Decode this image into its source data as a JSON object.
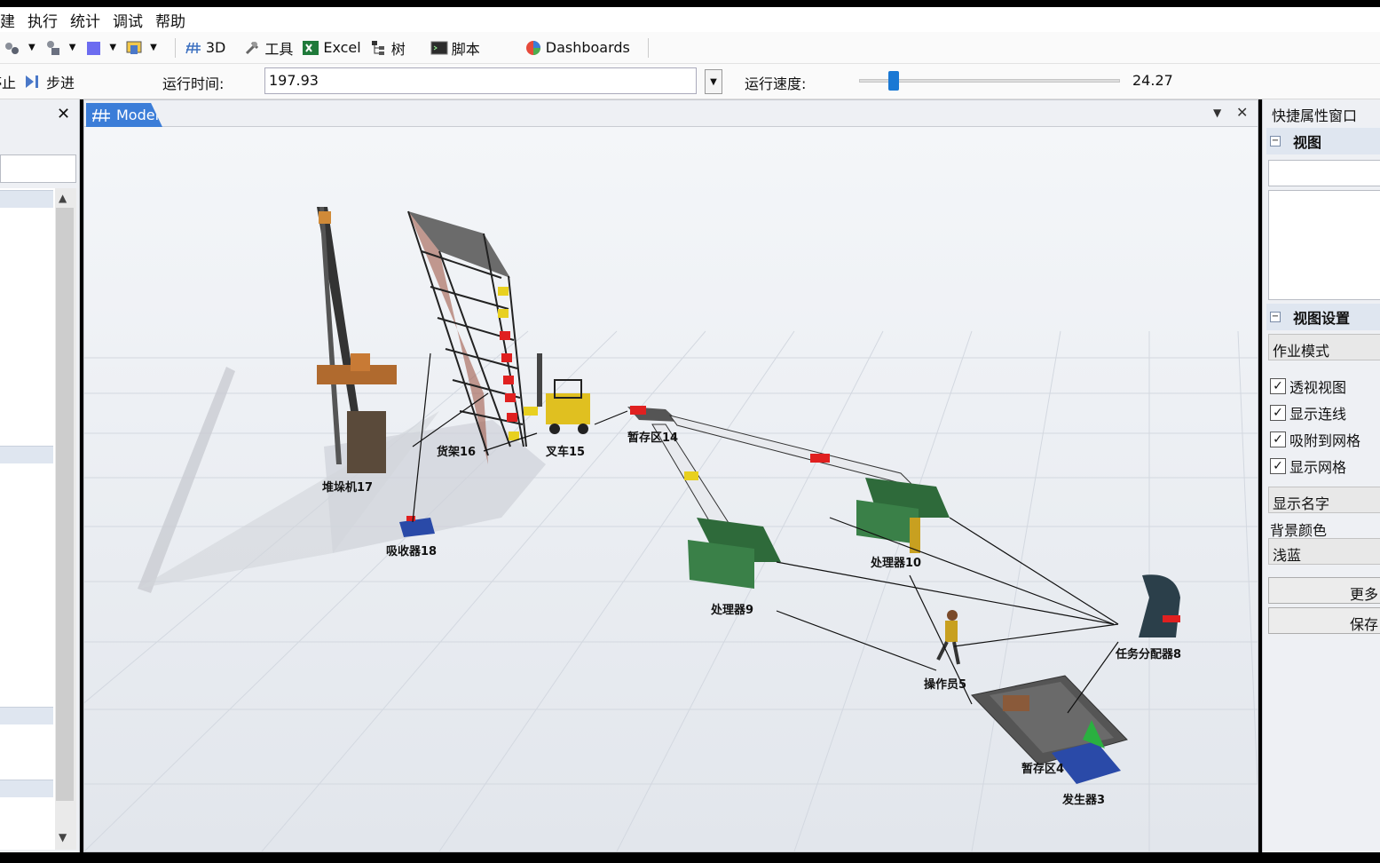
{
  "menu": [
    "建",
    "执行",
    "统计",
    "调试",
    "帮助"
  ],
  "toolbar": {
    "items": [
      {
        "icon": "connect-icon",
        "label": ""
      },
      {
        "icon": "objects-icon",
        "label": ""
      },
      {
        "icon": "color-square-icon",
        "label": ""
      },
      {
        "icon": "view-icon",
        "label": ""
      }
    ],
    "btn_3d": "3D",
    "btn_tools": "工具",
    "btn_excel": "Excel",
    "btn_tree": "树",
    "btn_script": "脚本",
    "btn_dashboards": "Dashboards"
  },
  "runbar": {
    "stop": "停止",
    "step": "步进",
    "time_label": "运行时间:",
    "time_value": "197.93",
    "speed_label": "运行速度:",
    "speed_value": "24.27"
  },
  "model_tab": "Model",
  "scene_labels": {
    "stacker": "堆垛机17",
    "rack": "货架16",
    "forklift": "叉车15",
    "queue14": "暂存区14",
    "absorber": "吸收器18",
    "processor10": "处理器10",
    "processor9": "处理器9",
    "dispatcher": "任务分配器8",
    "operator": "操作员5",
    "queue4": "暂存区4",
    "source": "发生器3"
  },
  "right": {
    "title": "快捷属性窗口",
    "view_section": "视图",
    "view_settings_section": "视图设置",
    "mode_select": "作业模式",
    "checks": [
      {
        "label": "透视视图",
        "checked": true
      },
      {
        "label": "显示连线",
        "checked": true
      },
      {
        "label": "吸附到网格",
        "checked": true
      },
      {
        "label": "显示网格",
        "checked": true
      }
    ],
    "show_names_select": "显示名字",
    "bg_label": "背景颜色",
    "bg_value": "浅蓝",
    "more_btn": "更多",
    "save_btn": "保存"
  }
}
